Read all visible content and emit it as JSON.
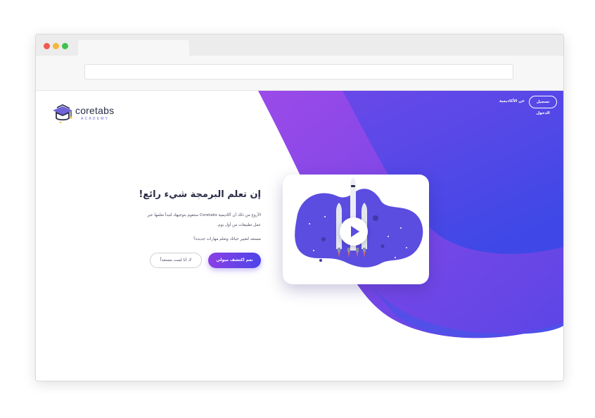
{
  "brand": {
    "name": "coretabs",
    "tagline": "ACADEMY"
  },
  "nav": {
    "login_label": "تسجيل الدخول",
    "about_label": "عن الأكاديمية"
  },
  "hero": {
    "title": "إن تعلم البرمجة شيء رائع!",
    "description": "الأروع من ذلك أن أكاديمية Coretabs ستقوم بتوجيهك لتبدأ تعلمها عبر عمل تطبيقات من أول يوم.",
    "question": "مستعد لتغيير حياتك وتعلم مهارات جديدة؟",
    "primary_button": "نعم اكتشف ميولي",
    "secondary_button": "لا, أنا لست مستعداً"
  },
  "colors": {
    "accent_start": "#8a3fe6",
    "accent_end": "#3a43e6",
    "blob": "#5b4de0",
    "text_dark": "#2a2c45"
  },
  "icons": {
    "play": "play-icon",
    "logo": "graduation-cap-icon",
    "rocket": "rocket-illustration"
  }
}
